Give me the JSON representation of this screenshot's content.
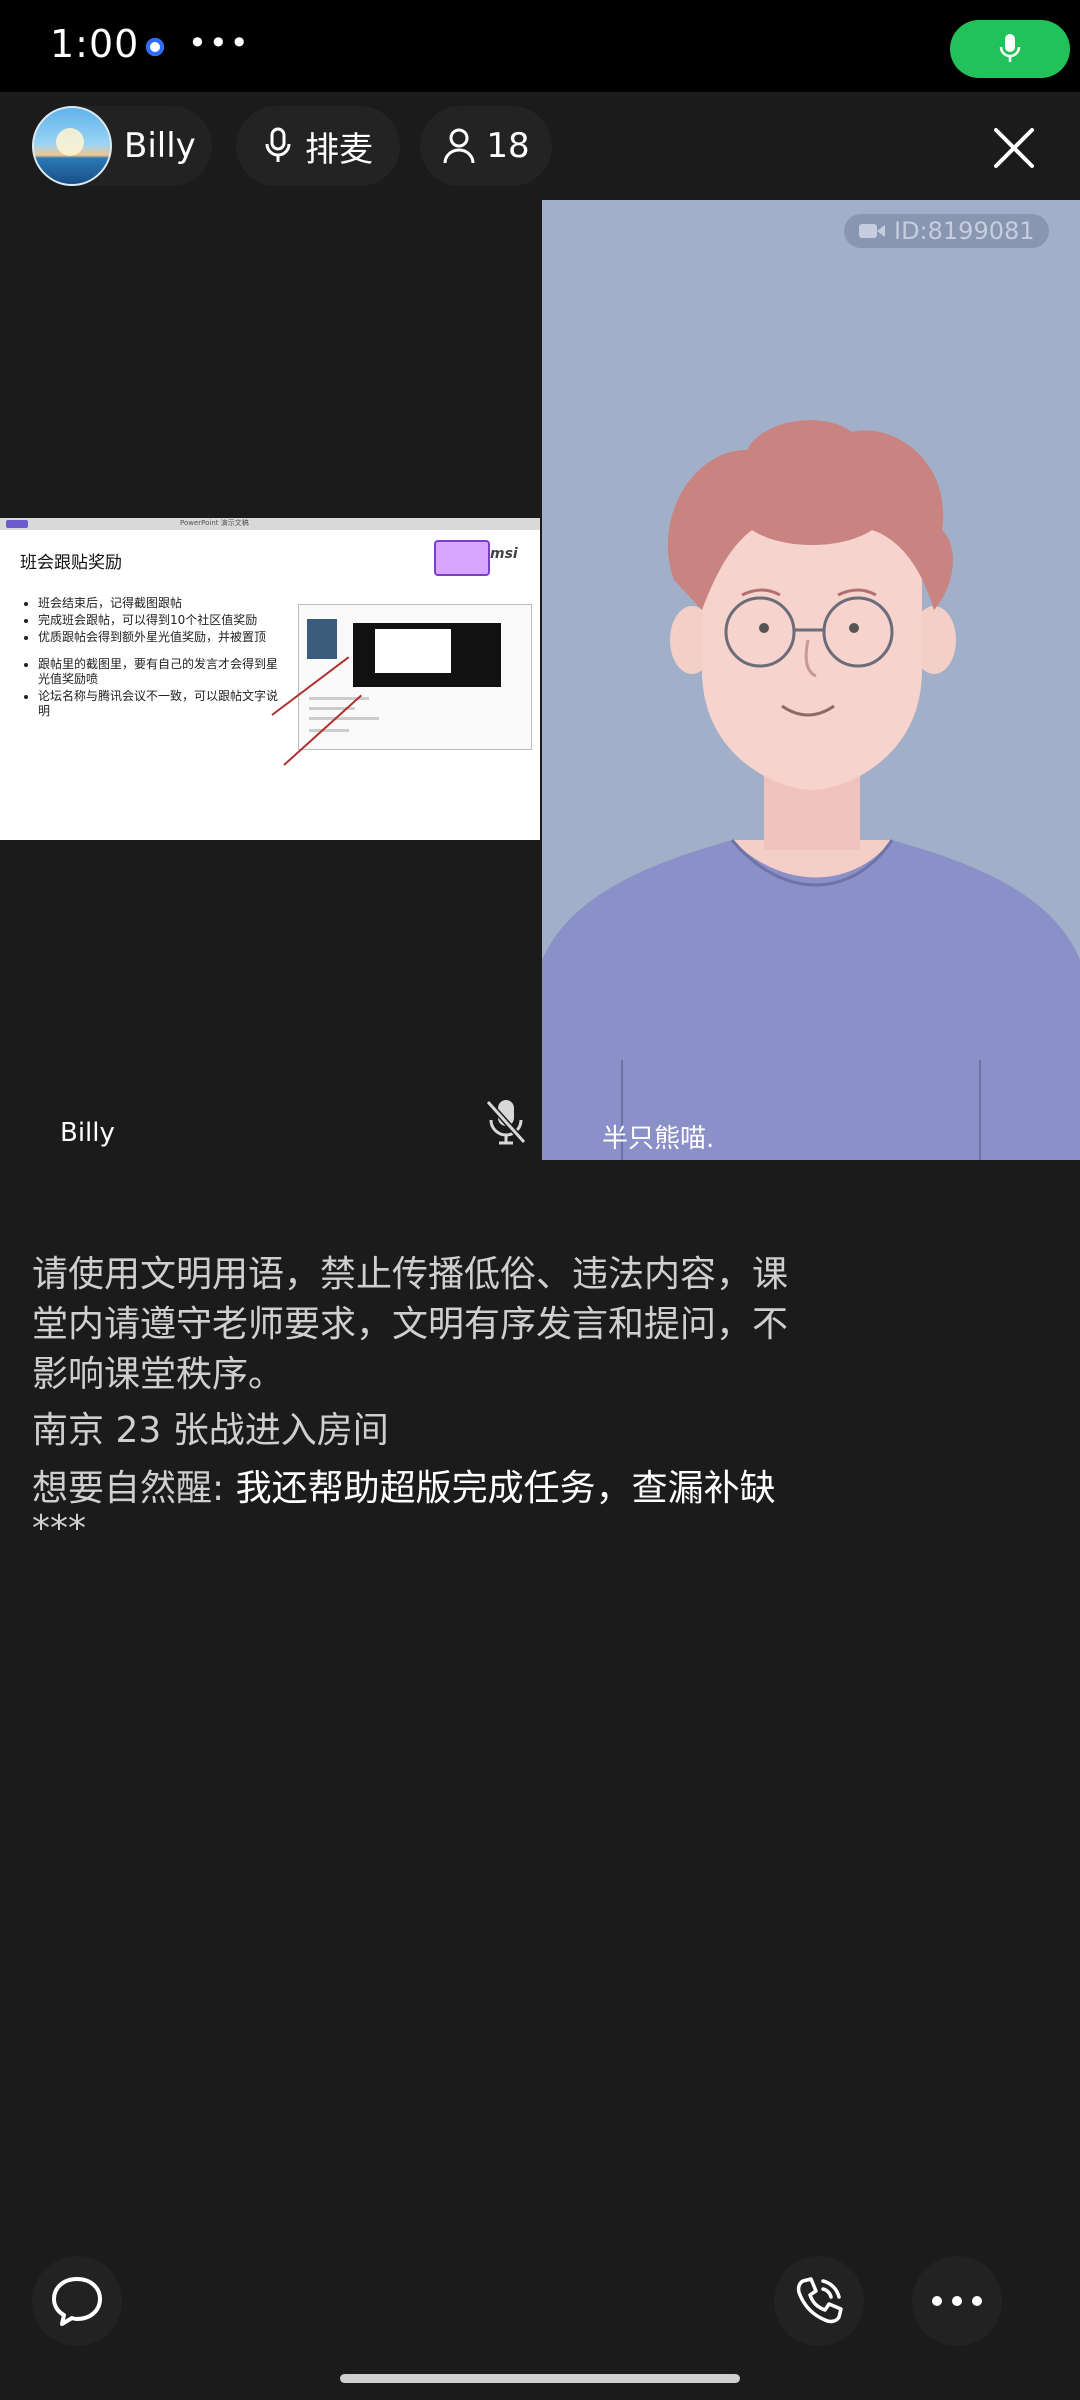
{
  "status_bar": {
    "time": "1:00",
    "more": "•••"
  },
  "header": {
    "host_name": "Billy",
    "queue_label": "排麦",
    "participant_count": "18"
  },
  "left_video": {
    "name": "Billy",
    "slide": {
      "caption": "PowerPoint 演示文稿",
      "title": "班会跟贴奖励",
      "msi": "msi",
      "bullets": [
        "班会结束后，记得截图跟帖",
        "完成班会跟帖，可以得到10个社区值奖励",
        "优质跟帖会得到额外星光值奖励，并被置顶",
        "跟帖里的截图里，要有自己的发言才会得到星光值奖励喷",
        "论坛名称与腾讯会议不一致，可以跟帖文字说明"
      ]
    }
  },
  "right_video": {
    "name": "半只熊喵.",
    "id_badge": "ID:8199081"
  },
  "chat": {
    "notice": "请使用文明用语，禁止传播低俗、违法内容，课堂内请遵守老师要求，文明有序发言和提问，不影响课堂秩序。",
    "enter": "南京 23 张战进入房间",
    "message_sender": "想要自然醒:",
    "message_text": " 我还帮助超版完成任务，查漏补缺",
    "masked": "***"
  },
  "colors": {
    "accent_green": "#23c15a",
    "background": "#1b1b1b",
    "video_bg": "#a1b0c8"
  }
}
